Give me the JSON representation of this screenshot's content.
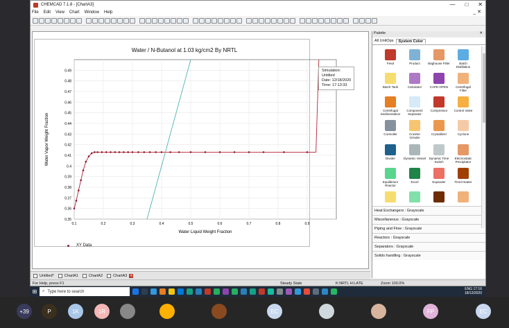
{
  "window": {
    "title": "CHEMCAD 7.1.8 - [ChartA3]",
    "controls": [
      "—",
      "□",
      "✕"
    ]
  },
  "menu": {
    "items": [
      "File",
      "Edit",
      "View",
      "Chart",
      "Window",
      "Help"
    ]
  },
  "chart": {
    "title": "Water / N-Butanol at     1.03 kg/cm2 By NRTL",
    "xlabel": "Water Liquid Weight Fraction",
    "ylabel": "Water Vapor Weight Fraction",
    "legend": "XY Data"
  },
  "sim": {
    "l1": "Simulation:",
    "l2": "Untitled",
    "l3": "Date: 12/18/2020",
    "l4": "Time: 17:13:33"
  },
  "chart_data": {
    "type": "line",
    "title": "Water / N-Butanol at 1.03 kg/cm2 By NRTL",
    "xlabel": "Water Liquid Weight Fraction",
    "ylabel": "Water Vapor Weight Fraction",
    "xlim": [
      0.1,
      1.0
    ],
    "ylim": [
      0.35,
      0.5
    ],
    "xticks": [
      0.1,
      0.2,
      0.3,
      0.4,
      0.5,
      0.6,
      0.7,
      0.8,
      0.9
    ],
    "yticks": [
      0.35,
      0.36,
      0.37,
      0.38,
      0.39,
      0.4,
      0.41,
      0.42,
      0.43,
      0.44,
      0.45,
      0.46,
      0.47,
      0.48,
      0.49
    ],
    "series": [
      {
        "name": "XY Data",
        "color": "#b22234",
        "x": [
          0.1,
          0.105,
          0.11,
          0.12,
          0.13,
          0.14,
          0.15,
          0.16,
          0.17,
          0.18,
          0.2,
          0.22,
          0.24,
          0.26,
          0.28,
          0.3,
          0.32,
          0.35,
          0.4,
          0.45,
          0.5,
          0.55,
          0.6,
          0.65,
          0.7,
          0.75,
          0.8,
          0.85,
          0.9,
          0.92,
          0.93,
          0.94
        ],
        "y": [
          0.36,
          0.365,
          0.371,
          0.383,
          0.395,
          0.404,
          0.409,
          0.412,
          0.413,
          0.413,
          0.413,
          0.413,
          0.413,
          0.413,
          0.413,
          0.413,
          0.413,
          0.413,
          0.413,
          0.413,
          0.413,
          0.413,
          0.413,
          0.413,
          0.413,
          0.413,
          0.413,
          0.413,
          0.413,
          0.413,
          0.413,
          0.5
        ]
      },
      {
        "name": "",
        "color": "#4fb3b0",
        "x": [
          0.35,
          0.5
        ],
        "y": [
          0.35,
          0.5
        ]
      }
    ],
    "marker_x": [
      0.1,
      0.107,
      0.115,
      0.123,
      0.131,
      0.14,
      0.15,
      0.16,
      0.17,
      0.18,
      0.195,
      0.21,
      0.225,
      0.24,
      0.255,
      0.27,
      0.285,
      0.3,
      0.32,
      0.34,
      0.36,
      0.38,
      0.4,
      0.43,
      0.46,
      0.5,
      0.55,
      0.6,
      0.65,
      0.7,
      0.75,
      0.82,
      0.9
    ],
    "grid": true,
    "legend": "bottom-left"
  },
  "palette": {
    "header": "Palette",
    "tabs": [
      "All UnitOps",
      "System Color"
    ],
    "items": [
      {
        "label": "Feed",
        "color": "#c0392b"
      },
      {
        "label": "Product",
        "color": "#7fb3d5"
      },
      {
        "label": "Baghouse Filter",
        "color": "#e59866"
      },
      {
        "label": "Batch Distillation",
        "color": "#5dade2"
      },
      {
        "label": "Batch Tank",
        "color": "#f7dc6f"
      },
      {
        "label": "Calculator",
        "color": "#af7ac5"
      },
      {
        "label": "CAPE-OPEN",
        "color": "#8e44ad"
      },
      {
        "label": "Centrifugal Filter",
        "color": "#f0b27a"
      },
      {
        "label": "Centrifugal Sedimentation",
        "color": "#e67e22"
      },
      {
        "label": "Component Separator",
        "color": "#d6eaf8"
      },
      {
        "label": "Compressor",
        "color": "#c0392b"
      },
      {
        "label": "Control Valve",
        "color": "#f5b041"
      },
      {
        "label": "Controller",
        "color": "#85929e"
      },
      {
        "label": "Crusher Grinder",
        "color": "#f8c471"
      },
      {
        "label": "Crystallizer",
        "color": "#eb984e"
      },
      {
        "label": "Cyclone",
        "color": "#f5cba7"
      },
      {
        "label": "Divider",
        "color": "#1f618d"
      },
      {
        "label": "Dynamic Vessel",
        "color": "#aab7b8"
      },
      {
        "label": "Dynamic Time Switch",
        "color": "#bfc9ca"
      },
      {
        "label": "Electrostatic Precipitator",
        "color": "#e59866"
      },
      {
        "label": "Equilibrium Reactor",
        "color": "#58d68d"
      },
      {
        "label": "Excel",
        "color": "#1e8449"
      },
      {
        "label": "Expander",
        "color": "#ec7063"
      },
      {
        "label": "Fired Heater",
        "color": "#a04000"
      },
      {
        "label": "",
        "color": "#f7dc6f"
      },
      {
        "label": "",
        "color": "#82e0aa"
      },
      {
        "label": "",
        "color": "#6e2c00"
      },
      {
        "label": "",
        "color": "#f0b27a"
      }
    ],
    "categories": [
      "Heat Exchangers : Grayscale",
      "Miscellaneous : Grayscale",
      "Piping and Flow : Grayscale",
      "Reactors : Grayscale",
      "Separators : Grayscale",
      "Solids handling : Grayscale"
    ]
  },
  "tabs": [
    "Untitled*",
    "ChartA1",
    "ChartA2",
    "ChartA3"
  ],
  "status": {
    "help": "For Help, press F1",
    "state": "Steady State",
    "model": "K:NRTL H:LATE",
    "zoom": "Zoom 100.0%"
  },
  "taskbar": {
    "search": "Type here to search",
    "lang": "ENG",
    "time": "17:16",
    "date": "18/12/2020"
  },
  "meeting": [
    {
      "name": "+39",
      "color": "#3a3a5c"
    },
    {
      "name": "P",
      "color": "#3b2f1e"
    },
    {
      "name": "1K",
      "color": "#a9c7e8"
    },
    {
      "name": "1R",
      "color": "#f4b6b6"
    },
    {
      "name": "",
      "color": "#888888"
    },
    {
      "name": "",
      "color": "#ffb000"
    },
    {
      "name": "",
      "color": "#8a4a20"
    },
    {
      "name": "EC",
      "color": "#c9d8ef"
    },
    {
      "name": "",
      "color": "#cfd8dc"
    },
    {
      "name": "",
      "color": "#d7b49e"
    },
    {
      "name": "FP",
      "color": "#e0b4d8"
    },
    {
      "name": "EC",
      "color": "#c9d8ef"
    }
  ]
}
